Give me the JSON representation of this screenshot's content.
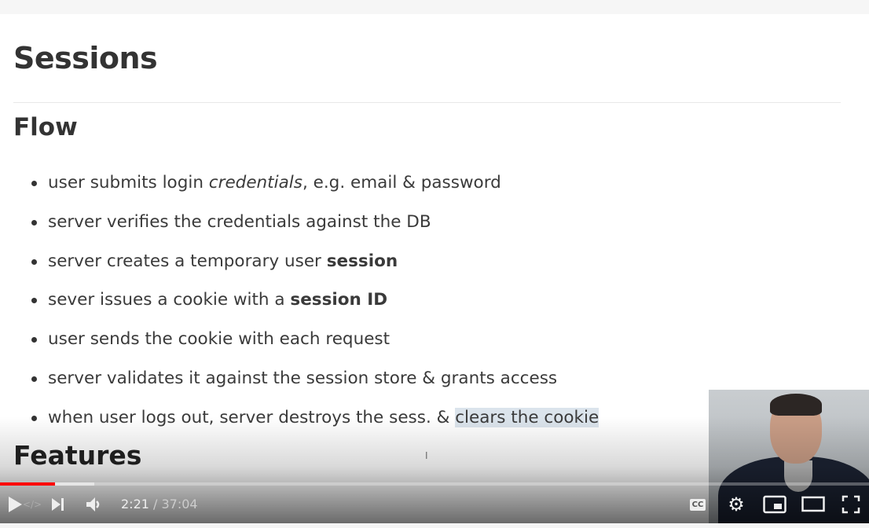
{
  "slide": {
    "title": "Sessions",
    "section": "Flow",
    "bullets": [
      {
        "parts": [
          "user submits login ",
          "credentials",
          ", e.g. email & password"
        ]
      },
      {
        "parts": [
          "server verifies the credentials against the DB"
        ]
      },
      {
        "parts": [
          "server creates a temporary user ",
          "session"
        ]
      },
      {
        "parts": [
          "sever issues a cookie with a ",
          "session ID"
        ]
      },
      {
        "parts": [
          "user sends the cookie with each request"
        ]
      },
      {
        "parts": [
          "server validates it against the session store & grants access"
        ]
      },
      {
        "parts": [
          "when user logs out, server destroys the sess. & ",
          "clears the cookie"
        ]
      }
    ],
    "next_section": "Features"
  },
  "player": {
    "current_time": "2:21",
    "separator": " / ",
    "duration": "37:04",
    "progress_fraction": 0.0634,
    "cc_label": "CC",
    "accent": "#ff0000"
  }
}
